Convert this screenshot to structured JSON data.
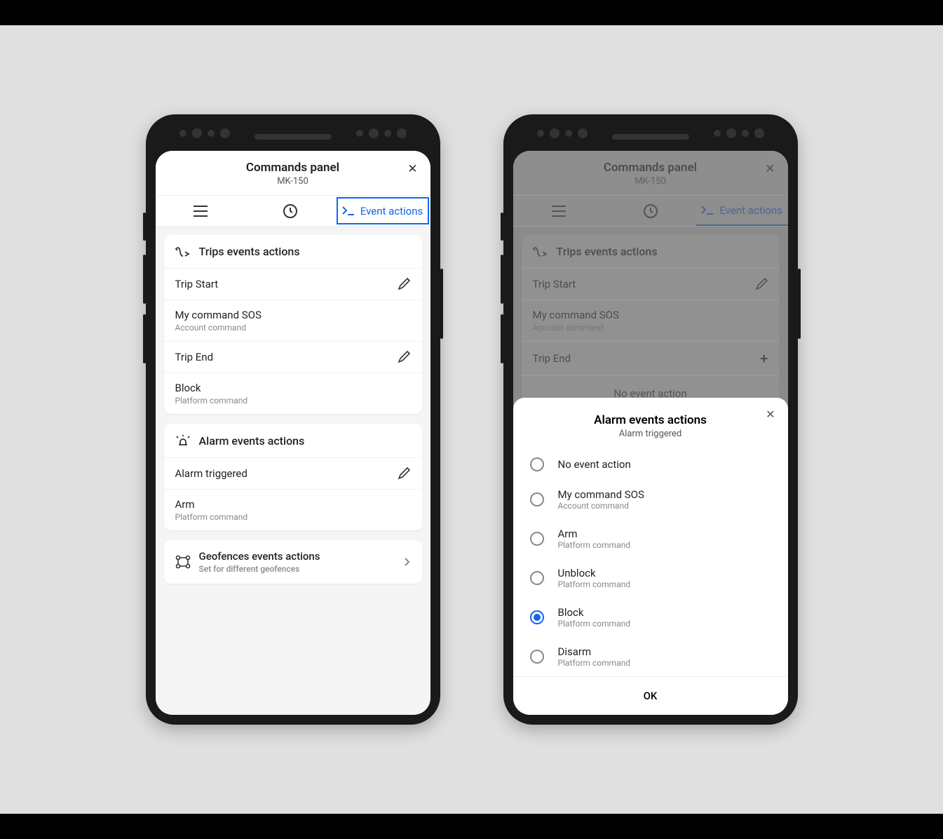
{
  "header": {
    "title": "Commands panel",
    "subtitle": "MK-150"
  },
  "tabs": {
    "event_actions": "Event actions"
  },
  "left": {
    "trips": {
      "title": "Trips events actions",
      "rows": [
        {
          "label": "Trip Start"
        },
        {
          "label": "My command SOS",
          "sub": "Account command"
        },
        {
          "label": "Trip End"
        },
        {
          "label": "Block",
          "sub": "Platform command"
        }
      ]
    },
    "alarm": {
      "title": "Alarm events actions",
      "rows": [
        {
          "label": "Alarm triggered"
        },
        {
          "label": "Arm",
          "sub": "Platform command"
        }
      ]
    },
    "geo": {
      "title": "Geofences events actions",
      "sub": "Set for different geofences"
    }
  },
  "right": {
    "trips": {
      "title": "Trips events actions",
      "rows": [
        {
          "label": "Trip Start"
        },
        {
          "label": "My command SOS",
          "sub": "Account command"
        },
        {
          "label": "Trip End"
        }
      ],
      "no_action": "No event action"
    },
    "alarm": {
      "title": "Alarm events actions",
      "rows": [
        {
          "label": "Alarm triggered"
        }
      ],
      "no_action": "No event action"
    }
  },
  "modal": {
    "title": "Alarm events actions",
    "subtitle": "Alarm triggered",
    "options": [
      {
        "label": "No event action"
      },
      {
        "label": "My command SOS",
        "sub": "Account command"
      },
      {
        "label": "Arm",
        "sub": "Platform command"
      },
      {
        "label": "Unblock",
        "sub": "Platform command"
      },
      {
        "label": "Block",
        "sub": "Platform command",
        "selected": true
      },
      {
        "label": "Disarm",
        "sub": "Platform command"
      }
    ],
    "ok": "OK"
  }
}
